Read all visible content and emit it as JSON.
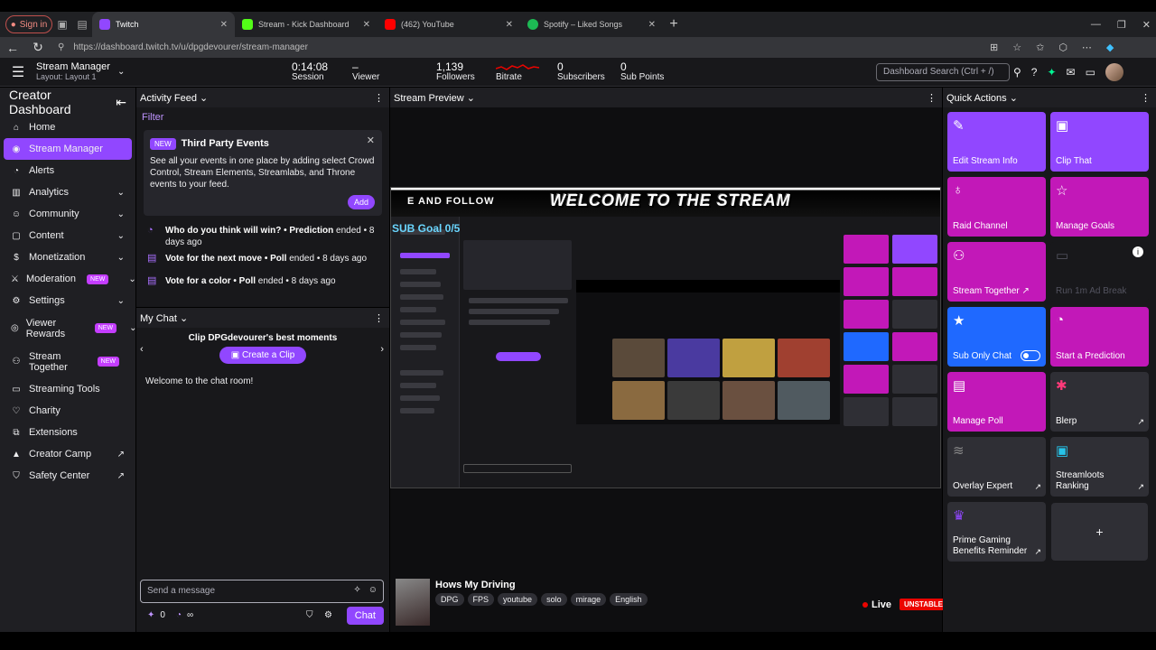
{
  "browser": {
    "profile_label": "Sign in",
    "tabs": [
      {
        "title": "Twitch",
        "color": "#9147ff"
      },
      {
        "title": "Stream - Kick Dashboard",
        "color": "#53fc18"
      },
      {
        "title": "(462) YouTube",
        "color": "#ff0000"
      },
      {
        "title": "Spotify – Liked Songs",
        "color": "#1db954"
      }
    ],
    "url": "https://dashboard.twitch.tv/u/dpgdevourer/stream-manager"
  },
  "topbar": {
    "title": "Stream Manager",
    "layout": "Layout: Layout 1",
    "stats": [
      {
        "value": "0:14:08",
        "label": "Session"
      },
      {
        "value": "–",
        "label": "Viewer"
      },
      {
        "value": "1,139",
        "label": "Followers"
      },
      {
        "value": "",
        "label": "Bitrate"
      },
      {
        "value": "0",
        "label": "Subscribers"
      },
      {
        "value": "0",
        "label": "Sub Points"
      }
    ],
    "search_placeholder": "Dashboard Search (Ctrl + /)"
  },
  "sidebar": {
    "header": "Creator Dashboard",
    "items": [
      {
        "label": "Home",
        "icon": "home-icon"
      },
      {
        "label": "Stream Manager",
        "icon": "broadcast-icon"
      },
      {
        "label": "Alerts",
        "icon": "bell-icon"
      },
      {
        "label": "Analytics",
        "icon": "chart-icon"
      },
      {
        "label": "Community",
        "icon": "people-icon"
      },
      {
        "label": "Content",
        "icon": "content-icon"
      },
      {
        "label": "Monetization",
        "icon": "money-icon"
      },
      {
        "label": "Moderation",
        "icon": "sword-icon"
      },
      {
        "label": "Settings",
        "icon": "gear-icon"
      },
      {
        "label": "Viewer Rewards",
        "icon": "reward-icon"
      },
      {
        "label": "Stream Together",
        "icon": "add-user-icon"
      },
      {
        "label": "Streaming Tools",
        "icon": "tools-icon"
      },
      {
        "label": "Charity",
        "icon": "heart-icon"
      },
      {
        "label": "Extensions",
        "icon": "extension-icon"
      },
      {
        "label": "Creator Camp",
        "icon": "camp-icon"
      },
      {
        "label": "Safety Center",
        "icon": "shield-icon"
      }
    ],
    "new_badge": "NEW"
  },
  "activity": {
    "title": "Activity Feed",
    "filter": "Filter",
    "card": {
      "badge": "NEW",
      "title": "Third Party Events",
      "body": "See all your events in one place by adding select Crowd Control, Stream Elements, Streamlabs, and Throne events to your feed.",
      "add": "Add"
    },
    "events": [
      {
        "bold": "Who do you think will win? • Prediction",
        "rest": " ended • 8 days ago"
      },
      {
        "bold": "Vote for the next move • Poll",
        "rest": " ended • 8 days ago"
      },
      {
        "bold": "Vote for a color • Poll",
        "rest": " ended • 8 days ago"
      }
    ]
  },
  "chat": {
    "title": "My Chat",
    "clip_heading": "Clip DPGdevourer's best moments",
    "clip_button": "Create a Clip",
    "welcome": "Welcome to the chat room!",
    "placeholder": "Send a message",
    "points": "0",
    "infinity": "∞",
    "send_button": "Chat"
  },
  "preview": {
    "title": "Stream Preview",
    "banner_text": "WELCOME TO THE STREAM",
    "banner_left": "E AND FOLLOW",
    "sub_goal": "SUB Goal 0/5",
    "stream_title": "Hows My Driving",
    "tags": [
      "DPG",
      "FPS",
      "youtube",
      "solo",
      "mirage",
      "English"
    ],
    "live": "Live",
    "unstable": "UNSTABLE"
  },
  "quick_actions": {
    "title": "Quick Actions",
    "tiles": [
      {
        "label": "Edit Stream Info",
        "icon": "pencil-icon"
      },
      {
        "label": "Clip That",
        "icon": "clapper-icon"
      },
      {
        "label": "Raid Channel",
        "icon": "raid-icon"
      },
      {
        "label": "Manage Goals",
        "icon": "star-icon"
      },
      {
        "label": "Stream Together ↗",
        "icon": "add-user-icon"
      },
      {
        "label": "Run 1m Ad Break",
        "icon": "ad-icon"
      },
      {
        "label": "Sub Only Chat",
        "icon": "star-icon"
      },
      {
        "label": "Start a Prediction",
        "icon": "prediction-icon"
      },
      {
        "label": "Manage Poll",
        "icon": "poll-icon"
      },
      {
        "label": "Blerp",
        "icon": "blerp-icon"
      },
      {
        "label": "Overlay Expert",
        "icon": "layers-icon"
      },
      {
        "label": "Streamloots Ranking",
        "icon": "streamloots-icon"
      },
      {
        "label": "Prime Gaming Benefits Reminder",
        "icon": "crown-icon"
      }
    ],
    "plus": "+"
  },
  "colors": {
    "accent": "#9147ff",
    "magenta": "#c218b8",
    "blue": "#1f69ff",
    "live": "#eb0400"
  }
}
